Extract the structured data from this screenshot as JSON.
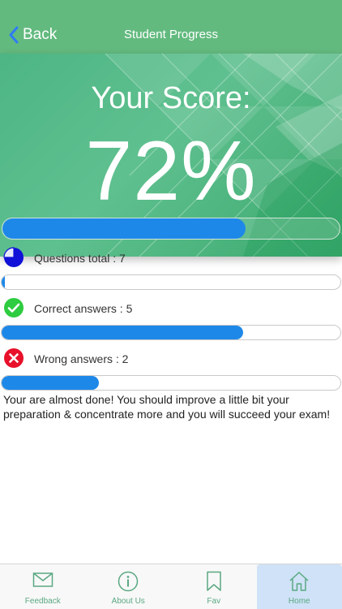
{
  "nav": {
    "back_label": "Back",
    "title": "Student Progress"
  },
  "score": {
    "label": "Your Score:",
    "value": "72%",
    "fraction": 0.72
  },
  "stats": [
    {
      "label": "Questions total : 7",
      "icon": "pie-clock-icon",
      "fraction": 0.01
    },
    {
      "label": "Correct answers : 5",
      "icon": "checkmark-icon",
      "fraction": 0.714
    },
    {
      "label": "Wrong answers : 2",
      "icon": "cross-icon",
      "fraction": 0.286
    }
  ],
  "message": "Your are almost done! You should improve a little bit your preparation & concentrate more and you will succeed your exam!",
  "tabs": [
    {
      "label": "Feedback",
      "icon": "envelope-icon"
    },
    {
      "label": "About Us",
      "icon": "info-icon"
    },
    {
      "label": "Fav",
      "icon": "bookmark-icon"
    },
    {
      "label": "Home",
      "icon": "home-icon",
      "active": true
    }
  ],
  "colors": {
    "nav_green": "#63ba7f",
    "progress_blue": "#1e88e8",
    "correct_green": "#2ecc40",
    "wrong_red": "#e8102a",
    "total_blue": "#1010d8",
    "tab_active_bg": "#cfe2f7"
  }
}
